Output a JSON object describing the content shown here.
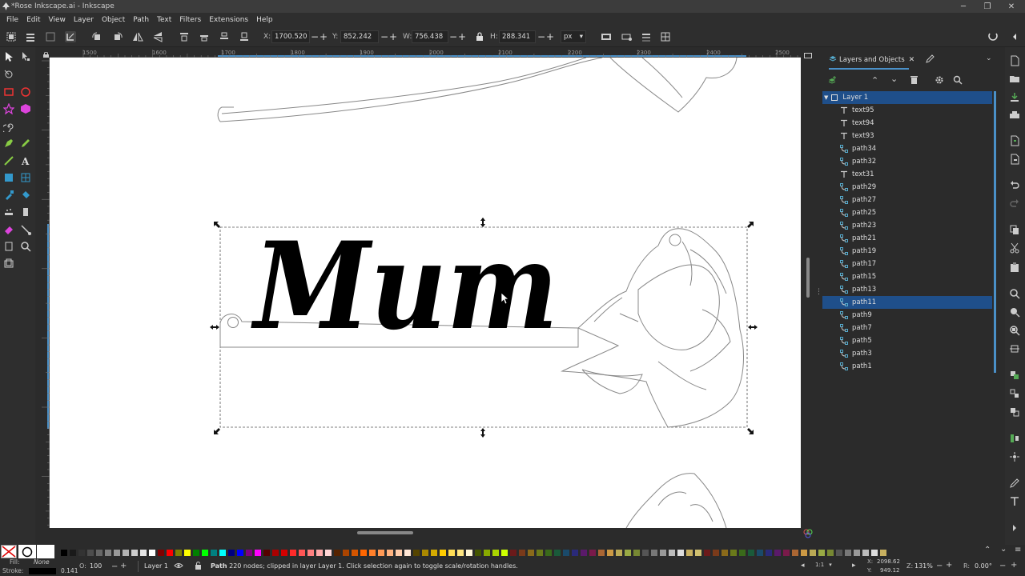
{
  "window": {
    "title": "*Rose Inkscape.ai - Inkscape"
  },
  "menu": [
    "File",
    "Edit",
    "View",
    "Layer",
    "Object",
    "Path",
    "Text",
    "Filters",
    "Extensions",
    "Help"
  ],
  "toolbar": {
    "x_label": "X:",
    "x_value": "1700.520",
    "y_label": "Y:",
    "y_value": "852.242",
    "w_label": "W:",
    "w_value": "756.438",
    "h_label": "H:",
    "h_value": "288.341",
    "unit": "px"
  },
  "ruler": {
    "labels": [
      "1500",
      "1600",
      "1700",
      "1800",
      "1900",
      "2000",
      "2100",
      "2200",
      "2300",
      "2400",
      "2500"
    ]
  },
  "canvas": {
    "text": "Mum"
  },
  "panel": {
    "tab_label": "Layers and Objects",
    "layer": "Layer 1",
    "items": [
      "text95",
      "text94",
      "text93",
      "path34",
      "path32",
      "text31",
      "path29",
      "path27",
      "path25",
      "path23",
      "path21",
      "path19",
      "path17",
      "path15",
      "path13",
      "path11",
      "path9",
      "path7",
      "path5",
      "path3",
      "path1"
    ],
    "selected": "path11"
  },
  "status": {
    "fill_label": "Fill:",
    "fill_value": "None",
    "stroke_label": "Stroke:",
    "stroke_value": "0.141",
    "opacity_label": "O:",
    "opacity_value": "100",
    "layer_name": "Layer 1",
    "message_bold": "Path",
    "message_rest": " 220 nodes; clipped in layer Layer 1. Click selection again to toggle scale/rotation handles.",
    "x_label": "X:",
    "x_value": "2098.62",
    "y_label": "Y:",
    "y_value": "949.12",
    "zoom_label": "Z:",
    "zoom_value": "131%",
    "rotate_label": "R:",
    "rotate_value": "0.00°",
    "ratio": "1:1"
  },
  "colors": {
    "accent": "#1f4f8a",
    "palette": [
      "#000000",
      "#1a1a1a",
      "#333333",
      "#4d4d4d",
      "#666666",
      "#808080",
      "#999999",
      "#b3b3b3",
      "#cccccc",
      "#e6e6e6",
      "#ffffff",
      "#800000",
      "#ff0000",
      "#808000",
      "#ffff00",
      "#008000",
      "#00ff00",
      "#008080",
      "#00ffff",
      "#000080",
      "#0000ff",
      "#800080",
      "#ff00ff",
      "#550000",
      "#aa0000",
      "#d40000",
      "#ff2a2a",
      "#ff5555",
      "#ff8080",
      "#ffaaaa",
      "#ffd5d5",
      "#552200",
      "#aa4400",
      "#d45500",
      "#ff6600",
      "#ff7f2a",
      "#ff9955",
      "#ffb380",
      "#ffccaa",
      "#ffe6d5",
      "#554400",
      "#aa8800",
      "#d4aa00",
      "#ffcc00",
      "#ffdd55",
      "#ffe680",
      "#fff6d5",
      "#445500",
      "#88aa00",
      "#aad400",
      "#ccff00"
    ]
  }
}
